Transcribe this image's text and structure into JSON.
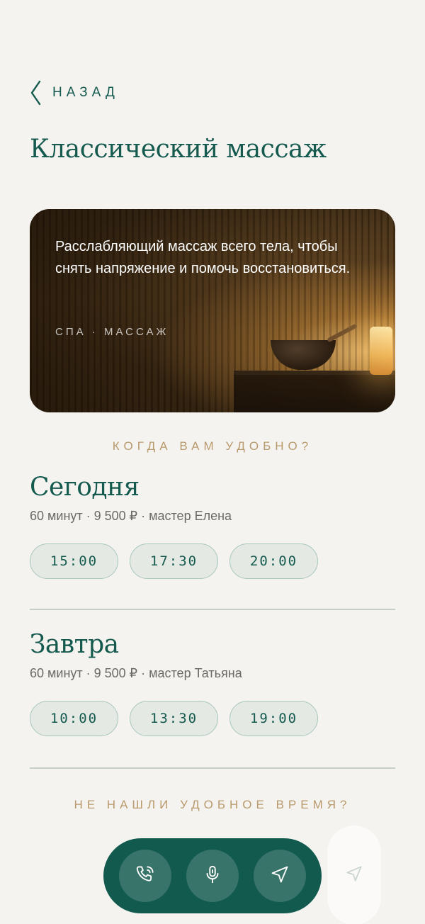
{
  "nav": {
    "back_label": "НАЗАД"
  },
  "page_title": "Классический массаж",
  "hero": {
    "description": "Расслабляющий массаж всего тела, чтобы снять напряжение и помочь восстановиться.",
    "tags": "СПА · МАССАЖ"
  },
  "booking": {
    "prompt": "КОГДА ВАМ УДОБНО?",
    "days": [
      {
        "title": "Сегодня",
        "meta": "60 минут · 9 500 ₽ · мастер Елена",
        "slots": [
          "15:00",
          "17:30",
          "20:00"
        ]
      },
      {
        "title": "Завтра",
        "meta": "60 минут · 9 500 ₽ · мастер Татьяна",
        "slots": [
          "10:00",
          "13:30",
          "19:00"
        ]
      }
    ],
    "not_found": "НЕ НАШЛИ УДОБНОЕ ВРЕМЯ?"
  },
  "dock": {
    "icons": [
      "phone-icon",
      "microphone-icon",
      "send-icon"
    ]
  },
  "colors": {
    "accent": "#155a4e",
    "gold": "#b99a6e",
    "background": "#f5f3ef"
  }
}
